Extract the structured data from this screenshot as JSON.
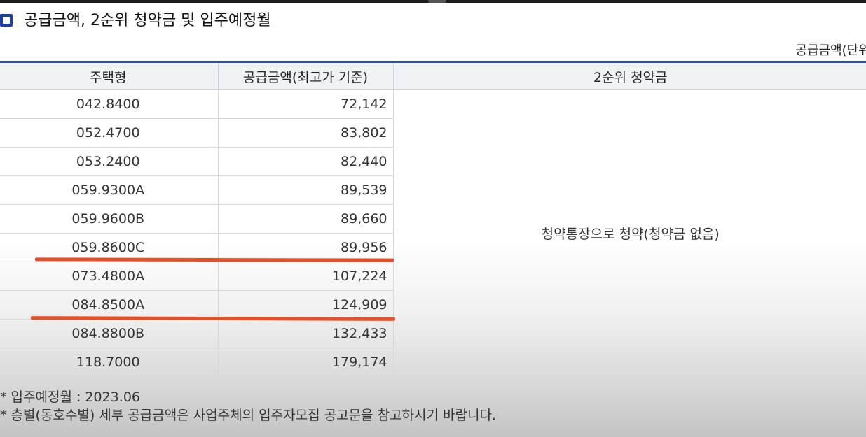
{
  "title": "공급금액, 2순위 청약금 및 입주예정월",
  "unit_note": "공급금액(단위:만원)",
  "table": {
    "headers": [
      "주택형",
      "공급금액(최고가 기준)",
      "2순위 청약금"
    ],
    "rows": [
      {
        "type": "042.8400",
        "price": "72,142"
      },
      {
        "type": "052.4700",
        "price": "83,802"
      },
      {
        "type": "053.2400",
        "price": "82,440"
      },
      {
        "type": "059.9300A",
        "price": "89,539"
      },
      {
        "type": "059.9600B",
        "price": "89,660"
      },
      {
        "type": "059.8600C",
        "price": "89,956"
      },
      {
        "type": "073.4800A",
        "price": "107,224"
      },
      {
        "type": "084.8500A",
        "price": "124,909"
      },
      {
        "type": "084.8800B",
        "price": "132,433"
      },
      {
        "type": "118.7000",
        "price": "179,174"
      }
    ],
    "deposit_text": "청약통장으로 청약(청약금 없음)"
  },
  "notes": [
    "* 입주예정월 : 2023.06",
    "* 층별(동호수별) 세부 공급금액은 사업주체의 입주자모집 공고문을 참고하시기 바랍니다."
  ],
  "colors": {
    "accent": "#2a4fa8",
    "header_bg": "#f1f2f5",
    "annotation": "#e4502a"
  }
}
